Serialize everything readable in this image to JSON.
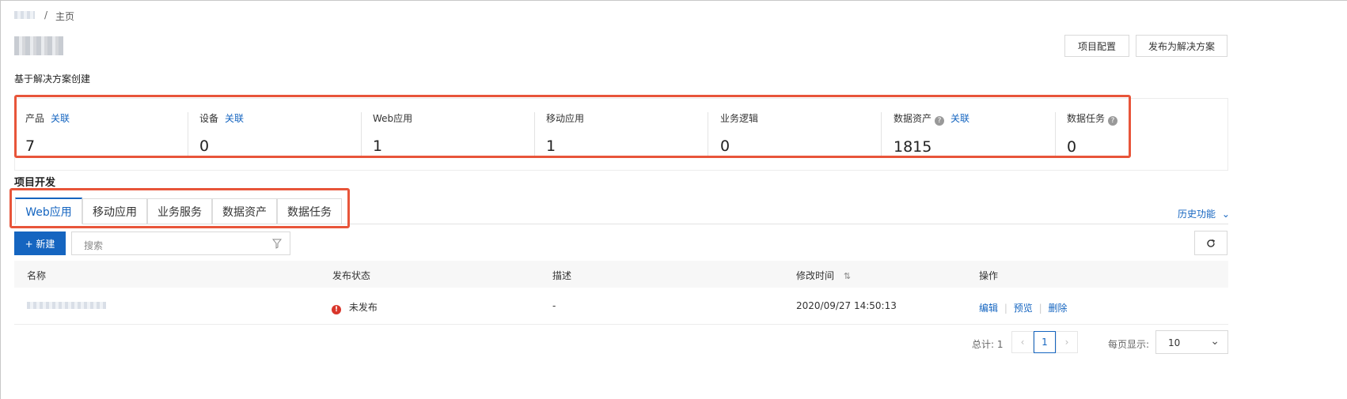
{
  "breadcrumb": {
    "separator": "/",
    "current": "主页"
  },
  "header": {
    "config_button": "项目配置",
    "publish_button": "发布为解决方案"
  },
  "solution_section": {
    "title": "基于解决方案创建"
  },
  "stats": [
    {
      "label": "产品",
      "link": "关联",
      "value": "7"
    },
    {
      "label": "设备",
      "link": "关联",
      "value": "0"
    },
    {
      "label": "Web应用",
      "value": "1"
    },
    {
      "label": "移动应用",
      "value": "1"
    },
    {
      "label": "业务逻辑",
      "value": "0"
    },
    {
      "label": "数据资产",
      "help": "?",
      "link": "关联",
      "value": "1815"
    },
    {
      "label": "数据任务",
      "help": "?",
      "value": "0"
    }
  ],
  "dev_section": {
    "title": "项目开发",
    "history": "历史功能"
  },
  "tabs": [
    "Web应用",
    "移动应用",
    "业务服务",
    "数据资产",
    "数据任务"
  ],
  "toolbar": {
    "new_button": "+ 新建",
    "search_placeholder": "搜索"
  },
  "table": {
    "headers": [
      "名称",
      "发布状态",
      "描述",
      "修改时间",
      "操作"
    ],
    "rows": [
      {
        "status": "未发布",
        "description": "-",
        "modified": "2020/09/27 14:50:13",
        "actions": [
          "编辑",
          "预览",
          "删除"
        ]
      }
    ]
  },
  "pagination": {
    "total": "总计: 1",
    "page": "1",
    "page_size_label": "每页显示:",
    "page_size": "10"
  },
  "colors": {
    "accent": "#1565c0",
    "highlight_border": "#e8553a",
    "error": "#d9362b"
  }
}
